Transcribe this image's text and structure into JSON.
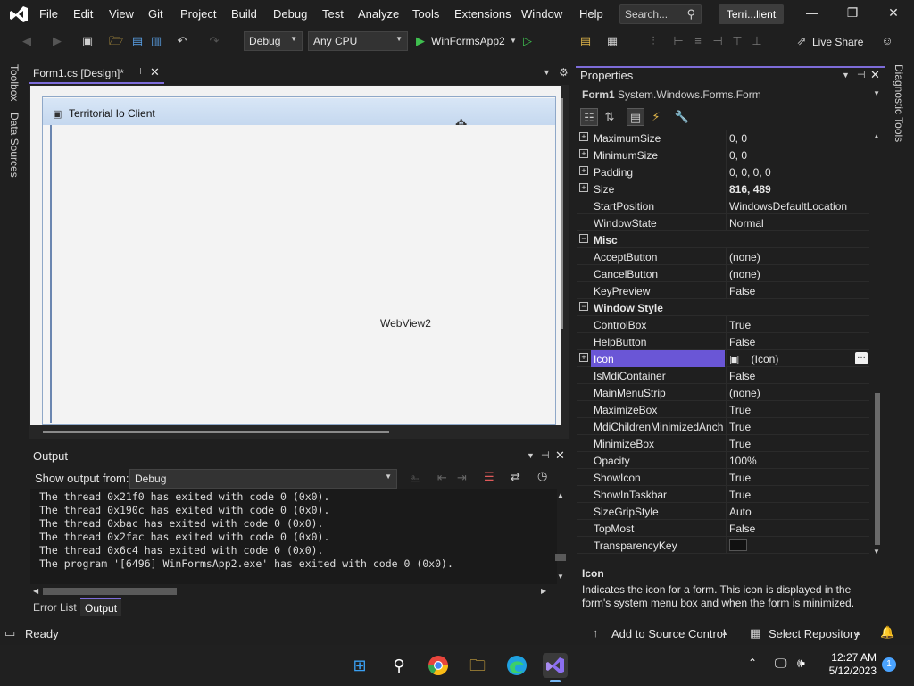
{
  "menu": {
    "items": [
      "File",
      "Edit",
      "View",
      "Git",
      "Project",
      "Build",
      "Debug",
      "Test",
      "Analyze",
      "Tools",
      "Extensions",
      "Window",
      "Help"
    ],
    "search_placeholder": "Search...",
    "solution_name": "Terri...lient"
  },
  "toolbar": {
    "config": "Debug",
    "platform": "Any CPU",
    "run_target": "WinFormsApp2",
    "live_share": "Live Share"
  },
  "left_strip": {
    "toolbox": "Toolbox",
    "data_sources": "Data Sources"
  },
  "right_strip": {
    "diagnostic": "Diagnostic Tools"
  },
  "document": {
    "tab_label": "Form1.cs [Design]*",
    "form_title": "Territorial Io Client",
    "webview_label": "WebView2"
  },
  "output": {
    "title": "Output",
    "show_from_label": "Show output from:",
    "source": "Debug",
    "lines": [
      "The thread 0x21f0 has exited with code 0 (0x0).",
      "The thread 0x190c has exited with code 0 (0x0).",
      "The thread 0xbac has exited with code 0 (0x0).",
      "The thread 0x2fac has exited with code 0 (0x0).",
      "The thread 0x6c4 has exited with code 0 (0x0).",
      "The program '[6496] WinFormsApp2.exe' has exited with code 0 (0x0)."
    ],
    "tabs": [
      "Error List",
      "Output"
    ]
  },
  "properties": {
    "title": "Properties",
    "object_name": "Form1",
    "object_type": "System.Windows.Forms.Form",
    "rows": [
      {
        "name": "MaximumSize",
        "value": "0, 0",
        "expand": true
      },
      {
        "name": "MinimumSize",
        "value": "0, 0",
        "expand": true
      },
      {
        "name": "Padding",
        "value": "0, 0, 0, 0",
        "expand": true
      },
      {
        "name": "Size",
        "value": "816, 489",
        "expand": true,
        "bold": true
      },
      {
        "name": "StartPosition",
        "value": "WindowsDefaultLocation"
      },
      {
        "name": "WindowState",
        "value": "Normal"
      },
      {
        "name": "Misc",
        "value": "",
        "category": true
      },
      {
        "name": "AcceptButton",
        "value": "(none)"
      },
      {
        "name": "CancelButton",
        "value": "(none)"
      },
      {
        "name": "KeyPreview",
        "value": "False"
      },
      {
        "name": "Window Style",
        "value": "",
        "category": true
      },
      {
        "name": "ControlBox",
        "value": "True"
      },
      {
        "name": "HelpButton",
        "value": "False"
      },
      {
        "name": "Icon",
        "value": "(Icon)",
        "expand": true,
        "selected": true
      },
      {
        "name": "IsMdiContainer",
        "value": "False"
      },
      {
        "name": "MainMenuStrip",
        "value": "(none)"
      },
      {
        "name": "MaximizeBox",
        "value": "True"
      },
      {
        "name": "MdiChildrenMinimizedAnch",
        "value": "True"
      },
      {
        "name": "MinimizeBox",
        "value": "True"
      },
      {
        "name": "Opacity",
        "value": "100%"
      },
      {
        "name": "ShowIcon",
        "value": "True"
      },
      {
        "name": "ShowInTaskbar",
        "value": "True"
      },
      {
        "name": "SizeGripStyle",
        "value": "Auto"
      },
      {
        "name": "TopMost",
        "value": "False"
      },
      {
        "name": "TransparencyKey",
        "value": "",
        "swatch": true
      }
    ],
    "desc_title": "Icon",
    "desc_text": "Indicates the icon for a form. This icon is displayed in the form's system menu box and when the form is minimized."
  },
  "status": {
    "ready": "Ready",
    "add_source": "Add to Source Control",
    "select_repo": "Select Repository"
  },
  "taskbar": {
    "time": "12:27 AM",
    "date": "5/12/2023",
    "notif_count": "1"
  },
  "colors": {
    "accent": "#7d6cd9",
    "selected_row": "#6a56d6",
    "run_green": "#3fbf4f"
  }
}
